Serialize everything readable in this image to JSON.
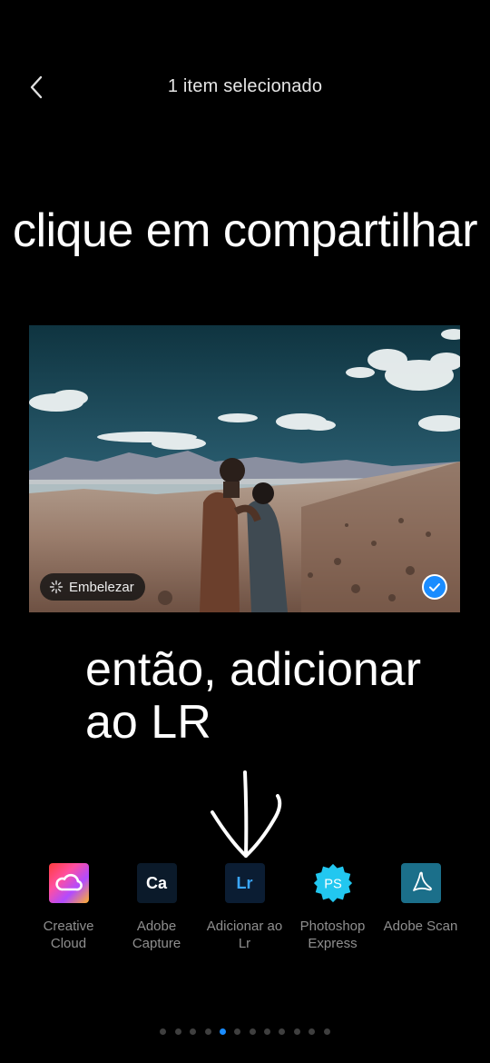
{
  "header": {
    "title": "1 item selecionado",
    "back_icon": "chevron-left-icon"
  },
  "annotations": {
    "top": "clique em compartilhar",
    "middle_line1": "então, adicionar",
    "middle_line2": "ao LR"
  },
  "photo": {
    "beautify_label": "Embelezar",
    "selected": true,
    "accent_color": "#1a8cff"
  },
  "share_targets": [
    {
      "label_line1": "Creative",
      "label_line2": "Cloud",
      "icon": "creative-cloud-icon"
    },
    {
      "label_line1": "Adobe",
      "label_line2": "Capture",
      "icon": "adobe-capture-icon",
      "glyph": "Ca"
    },
    {
      "label_line1": "Adicionar ao",
      "label_line2": "Lr",
      "icon": "lightroom-icon",
      "glyph": "Lr"
    },
    {
      "label_line1": "Photoshop",
      "label_line2": "Express",
      "icon": "photoshop-express-icon",
      "glyph": "PS"
    },
    {
      "label_line1": "Adobe Scan",
      "label_line2": "",
      "icon": "adobe-scan-icon"
    }
  ],
  "pager": {
    "total": 12,
    "active_index": 4
  }
}
